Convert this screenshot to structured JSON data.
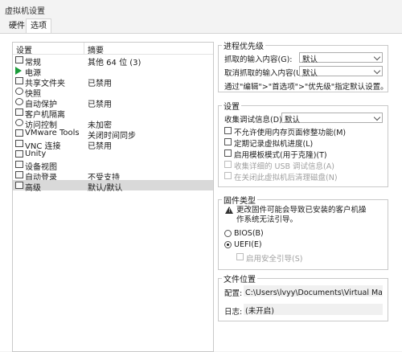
{
  "window": {
    "title": "虚拟机设置"
  },
  "tabs": [
    {
      "label": "硬件"
    },
    {
      "label": "选项"
    }
  ],
  "devices": {
    "header": {
      "col1": "设置",
      "col2": "摘要"
    },
    "items": [
      {
        "name": "常规",
        "summary": "其他 64 位 (3)",
        "icon": "general-icon"
      },
      {
        "name": "电源",
        "summary": "",
        "icon": "power-icon"
      },
      {
        "name": "共享文件夹",
        "summary": "已禁用",
        "icon": "shared-folder-icon"
      },
      {
        "name": "快照",
        "summary": "",
        "icon": "snapshot-icon"
      },
      {
        "name": "自动保护",
        "summary": "已禁用",
        "icon": "autoprotect-icon"
      },
      {
        "name": "客户机隔离",
        "summary": "",
        "icon": "isolation-icon"
      },
      {
        "name": "访问控制",
        "summary": "未加密",
        "icon": "access-control-icon"
      },
      {
        "name": "VMware Tools",
        "summary": "关闭时间同步",
        "icon": "vmware-tools-icon"
      },
      {
        "name": "VNC 连接",
        "summary": "已禁用",
        "icon": "vnc-icon"
      },
      {
        "name": "Unity",
        "summary": "",
        "icon": "unity-icon"
      },
      {
        "name": "设备视图",
        "summary": "",
        "icon": "device-view-icon"
      },
      {
        "name": "自动登录",
        "summary": "不受支持",
        "icon": "autologin-icon"
      },
      {
        "name": "高级",
        "summary": "默认/默认",
        "icon": "advanced-icon"
      }
    ]
  },
  "priority": {
    "title": "进程优先级",
    "grabbed_label": "抓取的输入内容(G):",
    "grabbed_value": "默认",
    "ungrabbed_label": "取消抓取的输入内容(U):",
    "ungrabbed_value": "默认",
    "hint": "通过\"编辑\">\"首选项\">\"优先级\"指定默认设置。"
  },
  "settings": {
    "title": "设置",
    "collect_label": "收集调试信息(D):",
    "collect_value": "默认",
    "options": [
      {
        "label": "不允许使用内存页面修整功能(M)",
        "enabled": true
      },
      {
        "label": "定期记录虚拟机进度(L)",
        "enabled": true
      },
      {
        "label": "启用模板模式(用于克隆)(T)",
        "enabled": true
      },
      {
        "label": "收集详细的 USB 调试信息(A)",
        "enabled": false
      },
      {
        "label": "在关闭此虚拟机后清理磁盘(N)",
        "enabled": false
      }
    ]
  },
  "firmware": {
    "title": "固件类型",
    "warning": "更改固件可能会导致已安装的客户机操作系统无法引导。",
    "bios_label": "BIOS(B)",
    "uefi_label": "UEFI(E)",
    "secure_boot_label": "启用安全引导(S)"
  },
  "files": {
    "title": "文件位置",
    "config_label": "配置:",
    "config_value": "C:\\Users\\lvyy\\Documents\\Virtual Machines\\其他",
    "log_label": "日志:",
    "log_value": "(未开启)"
  }
}
